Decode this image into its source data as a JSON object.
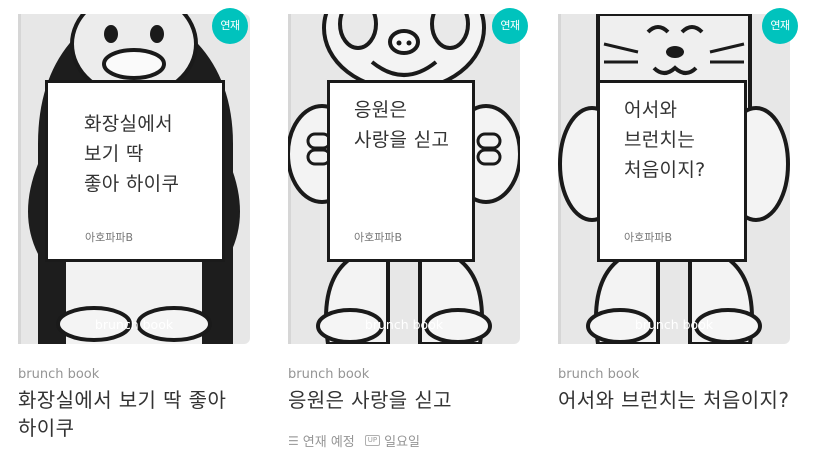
{
  "cards": [
    {
      "cover_title": "화장실에서\n보기 딱\n좋아 하이쿠",
      "cover_author": "아호파파B",
      "watermark": "brunch book",
      "badge": "연재",
      "label": "brunch book",
      "title": "화장실에서 보기 딱 좋아 하이쿠",
      "character": "penguin-icon"
    },
    {
      "cover_title": "응원은\n사랑을 싣고",
      "cover_author": "아호파파B",
      "watermark": "brunch book",
      "badge": "연재",
      "label": "brunch book",
      "title": "응원은 사랑을 싣고",
      "character": "monkey-icon",
      "schedule": {
        "status": "연재 예정",
        "day": "일요일",
        "up_icon": "UP"
      }
    },
    {
      "cover_title": "어서와\n브런치는\n처음이지?",
      "cover_author": "아호파파B",
      "watermark": "brunch book",
      "badge": "연재",
      "label": "brunch book",
      "title": "어서와 브런치는 처음이지?",
      "character": "cat-icon"
    }
  ],
  "colors": {
    "badge": "#00c3bd",
    "cover_bg": "#e7e7e7",
    "meta_text": "#959595",
    "title_text": "#333333"
  }
}
